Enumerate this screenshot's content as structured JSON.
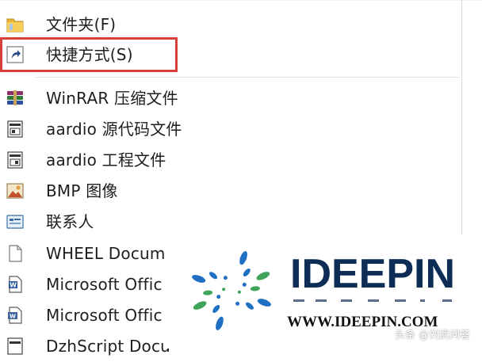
{
  "menu": {
    "items": [
      {
        "label": "文件夹(F)",
        "icon": "folder-icon"
      },
      {
        "label": "快捷方式(S)",
        "icon": "shortcut-icon"
      },
      {
        "label": "WinRAR 压缩文件",
        "icon": "winrar-archive-icon"
      },
      {
        "label": "aardio 源代码文件",
        "icon": "aardio-source-icon"
      },
      {
        "label": "aardio 工程文件",
        "icon": "aardio-project-icon"
      },
      {
        "label": "BMP 图像",
        "icon": "bmp-image-icon"
      },
      {
        "label": "联系人",
        "icon": "contact-icon"
      },
      {
        "label": "WHEEL Docum",
        "icon": "blank-document-icon"
      },
      {
        "label": "Microsoft Offic",
        "icon": "word-document-icon"
      },
      {
        "label": "Microsoft Offic",
        "icon": "word-template-icon"
      },
      {
        "label": "DzhScript Docu",
        "icon": "script-document-icon"
      }
    ],
    "highlighted_item": "快捷方式(S)",
    "highlight_color": "#d9403a"
  },
  "watermark": {
    "logo_text": "IDEEPIN",
    "url": "WWW.IDEEPIN.COM",
    "credit": "头条 @刘武问答",
    "brand_color": "#0d2d57",
    "accent_blue": "#1f6fc2",
    "accent_green": "#3fa35a"
  }
}
